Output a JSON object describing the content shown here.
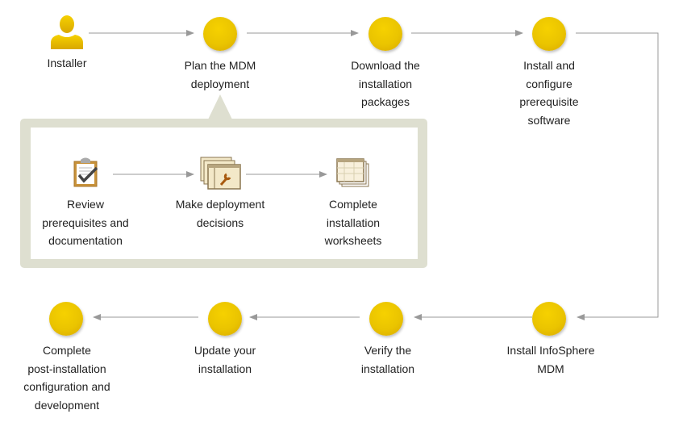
{
  "colors": {
    "node": "#eac400",
    "panel": "#dedfd0",
    "arrow": "#999999"
  },
  "actor": {
    "label": "Installer",
    "icon": "user-icon"
  },
  "top_steps": [
    {
      "label": "Plan the MDM\ndeployment"
    },
    {
      "label": "Download the\ninstallation\npackages"
    },
    {
      "label": "Install and\nconfigure\nprerequisite\nsoftware"
    }
  ],
  "sub_steps": [
    {
      "label": "Review\nprerequisites and\ndocumentation",
      "icon": "clipboard-check-icon"
    },
    {
      "label": "Make deployment\ndecisions",
      "icon": "windows-wrench-icon"
    },
    {
      "label": "Complete\ninstallation\nworksheets",
      "icon": "worksheet-icon"
    }
  ],
  "bottom_steps": [
    {
      "label": "Install InfoSphere\nMDM"
    },
    {
      "label": "Verify the\ninstallation"
    },
    {
      "label": "Update your\ninstallation"
    },
    {
      "label": "Complete\npost-installation\nconfiguration and\ndevelopment"
    }
  ]
}
